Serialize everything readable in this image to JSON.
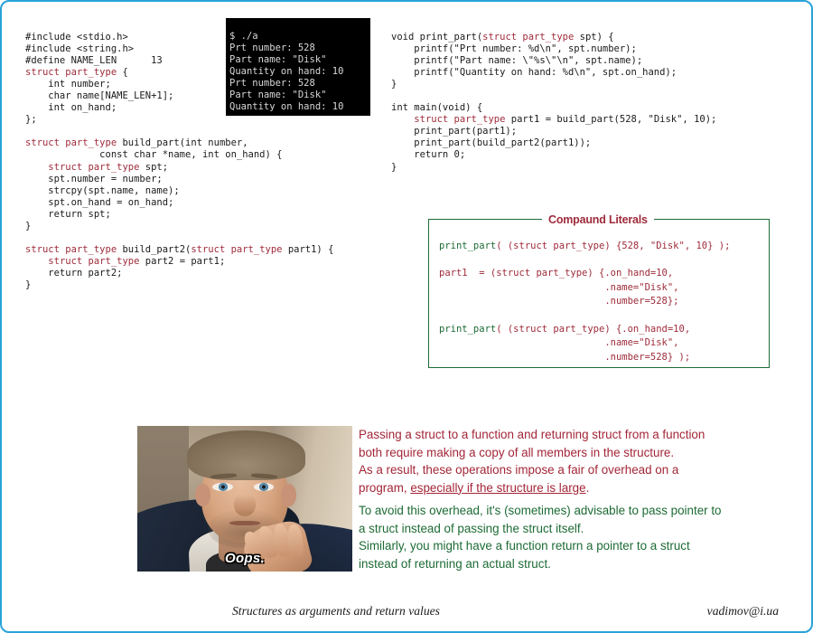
{
  "slide": {
    "border_color": "#2aa3d8",
    "background": "#ffffff"
  },
  "code_left": {
    "name": "left-source-code",
    "lines": [
      "#include <stdio.h>",
      "#include <string.h>",
      "#define NAME_LEN      13",
      "struct part_type {",
      "    int number;",
      "    char name[NAME_LEN+1];",
      "    int on_hand;",
      "};",
      "",
      "struct part_type build_part(int number,",
      "             const char *name, int on_hand) {",
      "    struct part_type spt;",
      "    spt.number = number;",
      "    strcpy(spt.name, name);",
      "    spt.on_hand = on_hand;",
      "    return spt;",
      "}",
      "",
      "struct part_type build_part2(struct part_type part1) {",
      "    struct part_type part2 = part1;",
      "    return part2;",
      "}"
    ],
    "keyword_color": "#9e2b3a",
    "text_color": "#1a1a1a"
  },
  "code_right": {
    "name": "right-source-code",
    "lines": [
      "void print_part(struct part_type spt) {",
      "    printf(\"Prt number: %d\\n\", spt.number);",
      "    printf(\"Part name: \\\"%s\\\"\\n\", spt.name);",
      "    printf(\"Quantity on hand: %d\\n\", spt.on_hand);",
      "}",
      "",
      "int main(void) {",
      "    struct part_type part1 = build_part(528, \"Disk\", 10);",
      "    print_part(part1);",
      "    print_part(build_part2(part1));",
      "    return 0;",
      "}"
    ]
  },
  "terminal": {
    "background": "#000000",
    "text_color": "#d8d8d8",
    "lines": [
      "$ ./a",
      "Prt number: 528",
      "Part name: \"Disk\"",
      "Quantity on hand: 10",
      "Prt number: 528",
      "Part name: \"Disk\"",
      "Quantity on hand: 10"
    ]
  },
  "literals_box": {
    "title": "Compaund Literals",
    "border_color": "#1d6b35",
    "title_color": "#9e2b3a",
    "code_color": "#9e2b3a",
    "fn_color": "#1d6b35",
    "lines": [
      "print_part( (struct part_type) {528, \"Disk\", 10} );",
      "",
      "part1  = (struct part_type) {.on_hand=10,",
      "                             .name=\"Disk\",",
      "                             .number=528};",
      "",
      "print_part( (struct part_type) {.on_hand=10,",
      "                             .name=\"Disk\",",
      "                             .number=528} );"
    ]
  },
  "photo": {
    "alt": "Surprised man with hand near mouth",
    "caption": "Oops."
  },
  "prose_red": {
    "color": "#a32638",
    "line1": "Passing a struct to a function and returning struct from a function",
    "line2": "both require making a copy of all members in the structure.",
    "line3": "As a result, these operations impose a fair of overhead on a",
    "line4_prefix": "program, ",
    "line4_underlined": "especially if the structure is large",
    "line4_suffix": "."
  },
  "prose_green": {
    "color": "#1d6b35",
    "text": "To avoid this overhead, it's (sometimes) advisable to pass pointer to\na struct instead of passing the struct itself.\nSimilarly, you might have a function return a pointer to a struct\ninstead of returning an actual struct."
  },
  "footer": {
    "title": "Structures as arguments and return values",
    "author": "vadimov@i.ua"
  }
}
